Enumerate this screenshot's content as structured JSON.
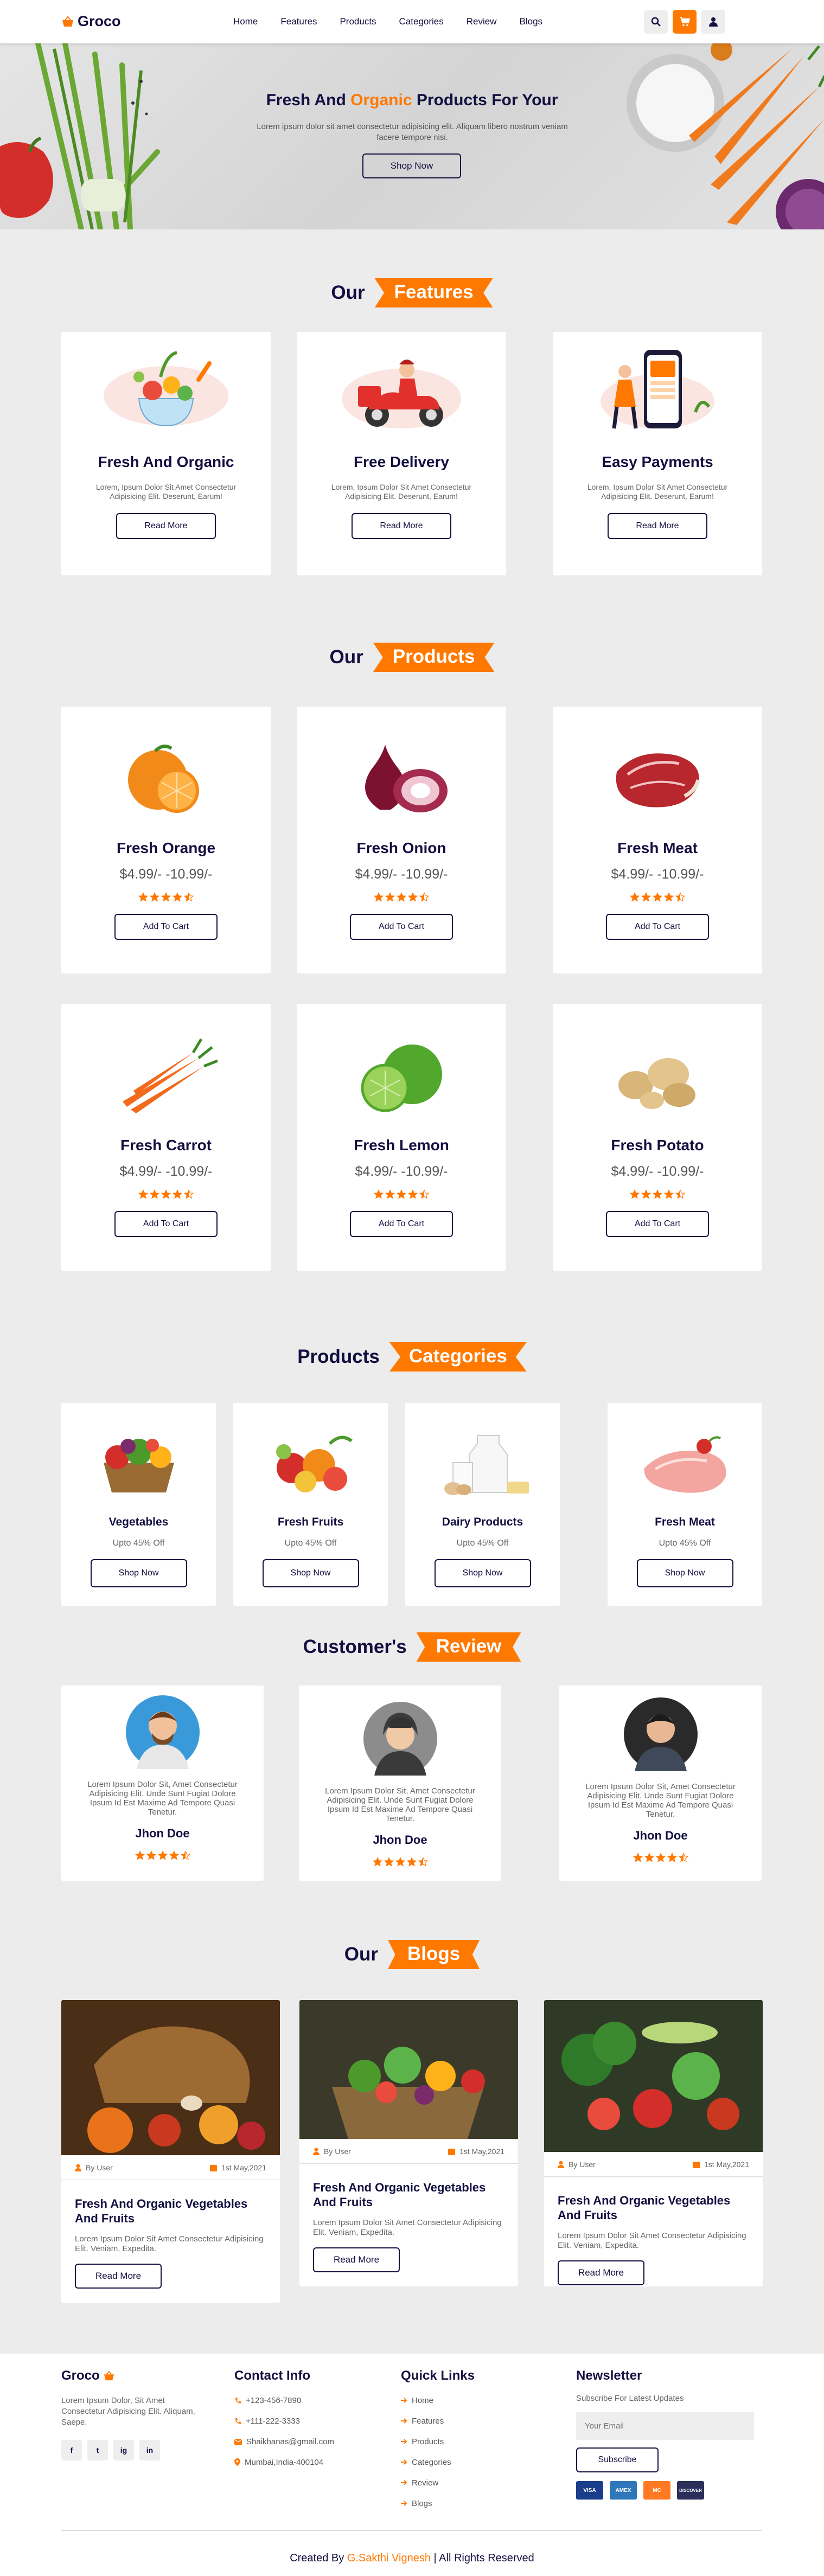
{
  "header": {
    "logo": "Groco",
    "nav": [
      "Home",
      "Features",
      "Products",
      "Categories",
      "Review",
      "Blogs"
    ],
    "icons": [
      "search-icon",
      "cart-icon",
      "user-icon"
    ]
  },
  "hero": {
    "title_pre": "Fresh And ",
    "title_accent": "Organic",
    "title_post": " Products For Your",
    "text": "Lorem ipsum dolor sit amet consectetur adipisicing elit. Aliquam libero nostrum veniam facere tempore nisi.",
    "button": "Shop Now"
  },
  "features": {
    "heading": "Our",
    "heading_tag": "Features",
    "items": [
      {
        "title": "Fresh And Organic",
        "text": "Lorem, Ipsum Dolor Sit Amet Consectetur Adipisicing Elit. Deserunt, Earum!",
        "button": "Read More"
      },
      {
        "title": "Free Delivery",
        "text": "Lorem, Ipsum Dolor Sit Amet Consectetur Adipisicing Elit. Deserunt, Earum!",
        "button": "Read More"
      },
      {
        "title": "Easy Payments",
        "text": "Lorem, Ipsum Dolor Sit Amet Consectetur Adipisicing Elit. Deserunt, Earum!",
        "button": "Read More"
      }
    ]
  },
  "products": {
    "heading": "Our",
    "heading_tag": "Products",
    "items": [
      {
        "title": "Fresh Orange",
        "price": "$4.99/- -10.99/-",
        "rating": 4.5,
        "button": "Add To Cart"
      },
      {
        "title": "Fresh Onion",
        "price": "$4.99/- -10.99/-",
        "rating": 4.5,
        "button": "Add To Cart"
      },
      {
        "title": "Fresh Meat",
        "price": "$4.99/- -10.99/-",
        "rating": 4.5,
        "button": "Add To Cart"
      },
      {
        "title": "Fresh Carrot",
        "price": "$4.99/- -10.99/-",
        "rating": 4.5,
        "button": "Add To Cart"
      },
      {
        "title": "Fresh Lemon",
        "price": "$4.99/- -10.99/-",
        "rating": 4.5,
        "button": "Add To Cart"
      },
      {
        "title": "Fresh Potato",
        "price": "$4.99/- -10.99/-",
        "rating": 4.5,
        "button": "Add To Cart"
      }
    ]
  },
  "categories": {
    "heading": "Products",
    "heading_tag": "Categories",
    "items": [
      {
        "title": "Vegetables",
        "sub": "Upto 45% Off",
        "button": "Shop Now"
      },
      {
        "title": "Fresh Fruits",
        "sub": "Upto 45% Off",
        "button": "Shop Now"
      },
      {
        "title": "Dairy Products",
        "sub": "Upto 45% Off",
        "button": "Shop Now"
      },
      {
        "title": "Fresh Meat",
        "sub": "Upto 45% Off",
        "button": "Shop Now"
      }
    ]
  },
  "reviews": {
    "heading": "Customer's",
    "heading_tag": "Review",
    "items": [
      {
        "text": "Lorem Ipsum Dolor Sit, Amet Consectetur Adipisicing Elit. Unde Sunt Fugiat Dolore Ipsum Id Est Maxime Ad Tempore Quasi Tenetur.",
        "name": "Jhon Doe",
        "rating": 4.5
      },
      {
        "text": "Lorem Ipsum Dolor Sit, Amet Consectetur Adipisicing Elit. Unde Sunt Fugiat Dolore Ipsum Id Est Maxime Ad Tempore Quasi Tenetur.",
        "name": "Jhon Doe",
        "rating": 4.5
      },
      {
        "text": "Lorem Ipsum Dolor Sit, Amet Consectetur Adipisicing Elit. Unde Sunt Fugiat Dolore Ipsum Id Est Maxime Ad Tempore Quasi Tenetur.",
        "name": "Jhon Doe",
        "rating": 4.5
      }
    ]
  },
  "blogs": {
    "heading": "Our",
    "heading_tag": "Blogs",
    "items": [
      {
        "by": "By User",
        "date": "1st May,2021",
        "title": "Fresh And Organic Vegetables And Fruits",
        "text": "Lorem Ipsum Dolor Sit Amet Consectetur Adipisicing Elit. Veniam, Expedita.",
        "button": "Read More"
      },
      {
        "by": "By User",
        "date": "1st May,2021",
        "title": "Fresh And Organic Vegetables And Fruits",
        "text": "Lorem Ipsum Dolor Sit Amet Consectetur Adipisicing Elit. Veniam, Expedita.",
        "button": "Read More"
      },
      {
        "by": "By User",
        "date": "1st May,2021",
        "title": "Fresh And Organic Vegetables And Fruits",
        "text": "Lorem Ipsum Dolor Sit Amet Consectetur Adipisicing Elit. Veniam, Expedita.",
        "button": "Read More"
      }
    ]
  },
  "footer": {
    "brand": "Groco",
    "brand_text": "Lorem Ipsum Dolor, Sit Amet Consectetur Adipisicing Elit. Aliquam, Saepe.",
    "social": [
      "f",
      "t",
      "ig",
      "in"
    ],
    "contact_heading": "Contact Info",
    "contact": [
      "+123-456-7890",
      "+111-222-3333",
      "Shaikhanas@gmail.com",
      "Mumbai,India-400104"
    ],
    "links_heading": "Quick Links",
    "links": [
      "Home",
      "Features",
      "Products",
      "Categories",
      "Review",
      "Blogs"
    ],
    "newsletter_heading": "Newsletter",
    "newsletter_text": "Subscribe For Latest Updates",
    "email_placeholder": "Your Email",
    "subscribe": "Subscribe",
    "payments": [
      "VISA",
      "AMEX",
      "MC",
      "DISCOVER"
    ],
    "credit_pre": "Created By ",
    "credit_name": "G.Sakthi Vignesh",
    "credit_post": " | All Rights Reserved"
  },
  "colors": {
    "accent": "#ff7800",
    "dark": "#130f40",
    "background": "#ececec"
  }
}
